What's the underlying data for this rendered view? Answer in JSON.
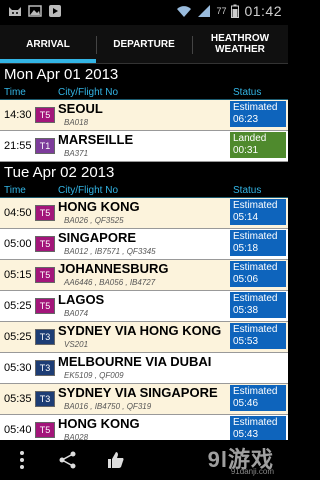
{
  "status_bar": {
    "time": "01:42",
    "battery": "77"
  },
  "tabs": [
    {
      "label": "ARRIVAL",
      "active": true
    },
    {
      "label": "DEPARTURE",
      "active": false
    },
    {
      "label": "HEATHROW WEATHER",
      "active": false
    }
  ],
  "columns": {
    "time": "Time",
    "city": "City/Flight No",
    "status": "Status"
  },
  "days": [
    {
      "date": "Mon Apr 01 2013",
      "flights": [
        {
          "time": "14:30",
          "terminal": "T5",
          "city": "SEOUL",
          "flights": "BA018",
          "status": "Estimated",
          "status_time": "06:23",
          "status_kind": "est",
          "row": "cream"
        },
        {
          "time": "21:55",
          "terminal": "T1",
          "city": "MARSEILLE",
          "flights": "BA371",
          "status": "Landed",
          "status_time": "00:31",
          "status_kind": "land",
          "row": "white"
        }
      ]
    },
    {
      "date": "Tue Apr 02 2013",
      "flights": [
        {
          "time": "04:50",
          "terminal": "T5",
          "city": "HONG KONG",
          "flights": "BA026 , QF3525",
          "status": "Estimated",
          "status_time": "05:14",
          "status_kind": "est",
          "row": "cream"
        },
        {
          "time": "05:00",
          "terminal": "T5",
          "city": "SINGAPORE",
          "flights": "BA012 , IB7571 , QF3345",
          "status": "Estimated",
          "status_time": "05:18",
          "status_kind": "est",
          "row": "white"
        },
        {
          "time": "05:15",
          "terminal": "T5",
          "city": "JOHANNESBURG",
          "flights": "AA6446 , BA056 , IB4727",
          "status": "Estimated",
          "status_time": "05:06",
          "status_kind": "est",
          "row": "cream"
        },
        {
          "time": "05:25",
          "terminal": "T5",
          "city": "LAGOS",
          "flights": "BA074",
          "status": "Estimated",
          "status_time": "05:38",
          "status_kind": "est",
          "row": "white"
        },
        {
          "time": "05:25",
          "terminal": "T3",
          "city": "SYDNEY VIA HONG KONG",
          "flights": "VS201",
          "status": "Estimated",
          "status_time": "05:53",
          "status_kind": "est",
          "row": "cream"
        },
        {
          "time": "05:30",
          "terminal": "T3",
          "city": "MELBOURNE VIA DUBAI",
          "flights": "EK5109 , QF009",
          "status": "",
          "status_time": "",
          "status_kind": "none",
          "row": "white"
        },
        {
          "time": "05:35",
          "terminal": "T3",
          "city": "SYDNEY VIA SINGAPORE",
          "flights": "BA016 , IB4750 , QF319",
          "status": "Estimated",
          "status_time": "05:46",
          "status_kind": "est",
          "row": "cream"
        },
        {
          "time": "05:40",
          "terminal": "T5",
          "city": "HONG KONG",
          "flights": "BA028",
          "status": "Estimated",
          "status_time": "05:43",
          "status_kind": "est",
          "row": "white"
        }
      ]
    }
  ],
  "nav": {
    "icons": [
      "overflow-menu-icon",
      "share-icon",
      "like-icon"
    ]
  },
  "watermark": {
    "brand": "9l游戏",
    "url": "91danji.com"
  },
  "colors": {
    "accent": "#33b5e5",
    "estimated": "#0e64bc",
    "landed": "#4f8a2d",
    "t5": "#a3157a",
    "t1": "#7d3c9b",
    "t3": "#1d3d75"
  }
}
